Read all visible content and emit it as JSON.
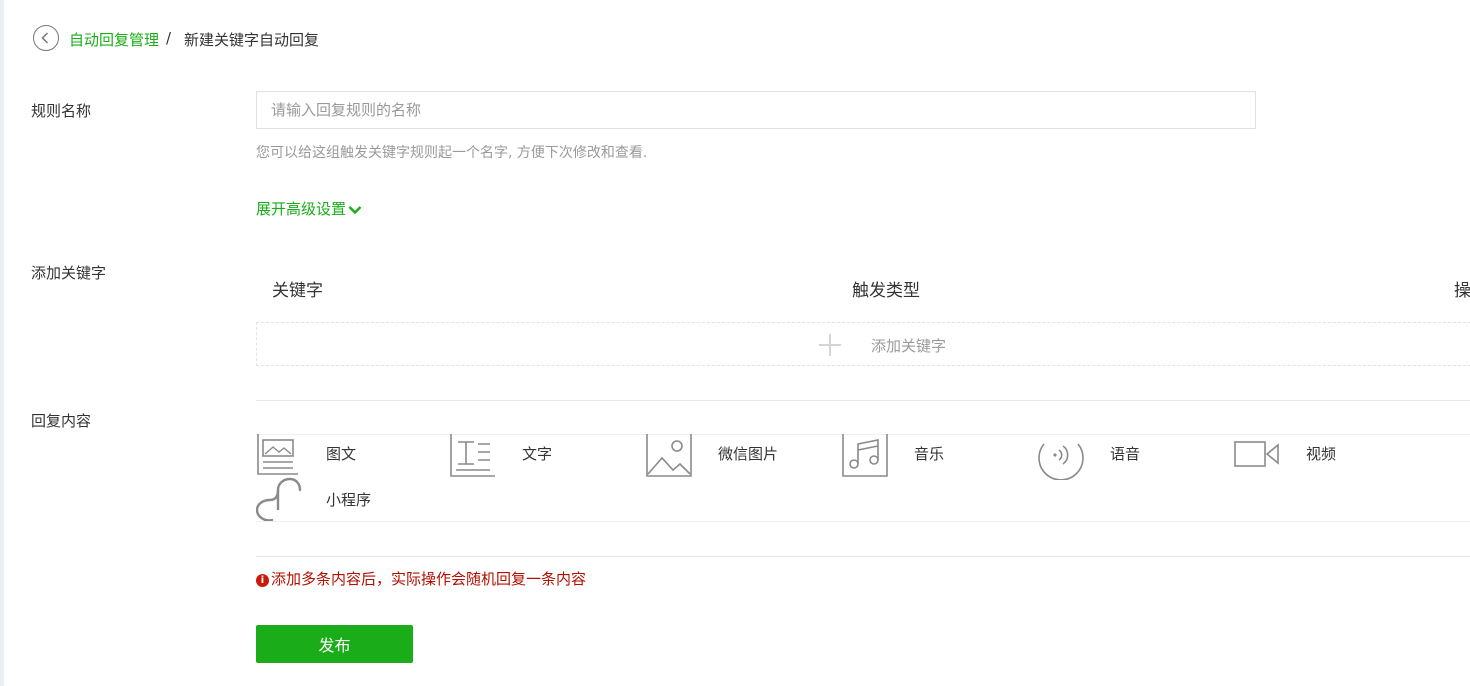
{
  "breadcrumb": {
    "parent": "自动回复管理",
    "separator": "/",
    "current": "新建关键字自动回复"
  },
  "rule_name": {
    "label": "规则名称",
    "value": "",
    "placeholder": "请输入回复规则的名称",
    "hint": "您可以给这组触发关键字规则起一个名字, 方便下次修改和查看.",
    "advanced_link": "展开高级设置"
  },
  "keywords": {
    "label": "添加关键字",
    "columns": [
      "关键字",
      "触发类型",
      "操"
    ],
    "add_button": "添加关键字"
  },
  "reply": {
    "label": "回复内容",
    "types": [
      {
        "label": "图文",
        "icon": "news-icon"
      },
      {
        "label": "文字",
        "icon": "text-icon"
      },
      {
        "label": "微信图片",
        "icon": "image-icon"
      },
      {
        "label": "音乐",
        "icon": "music-icon"
      },
      {
        "label": "语音",
        "icon": "voice-icon"
      },
      {
        "label": "视频",
        "icon": "video-icon"
      },
      {
        "label": "小程序",
        "icon": "miniprogram-icon"
      }
    ],
    "warning": "添加多条内容后，实际操作会随机回复一条内容"
  },
  "publish_button": "发布",
  "colors": {
    "accent": "#1aad19",
    "warning": "#b20f00",
    "icon": "#8a8a8a"
  }
}
